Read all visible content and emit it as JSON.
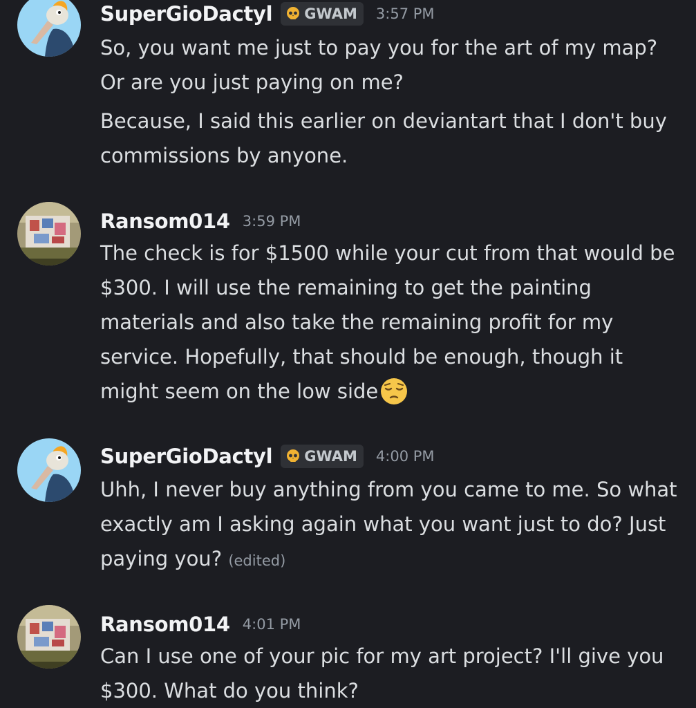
{
  "messages": [
    {
      "author": "SuperGioDactyl",
      "tag": "GWAM",
      "time": "3:57 PM",
      "lines": [
        "So, you want me just to pay you for the art of my map? Or are you just paying on me?",
        "Because, I said this earlier on deviantart that I don't buy commissions by anyone."
      ]
    },
    {
      "author": "Ransom014",
      "time": "3:59 PM",
      "lines": [
        "The check is for $1500 while your cut from that would be $300. I will use the remaining to get the painting materials and also take the remaining profit for my service. Hopefully, that should be enough, though it might seem on the low side"
      ],
      "emoji": "pensive-face"
    },
    {
      "author": "SuperGioDactyl",
      "tag": "GWAM",
      "time": "4:00 PM",
      "lines": [
        "Uhh, I never buy anything from you came to me. So what exactly am I asking again what you want just to do? Just paying you?"
      ],
      "edited": "(edited)"
    },
    {
      "author": "Ransom014",
      "time": "4:01 PM",
      "lines": [
        "Can I use one of your pic for my art project? I'll give you $300. What do you think?"
      ]
    }
  ],
  "colors": {
    "background": "#1c1d22",
    "username": "#f2f3f5",
    "text": "#dbdee1",
    "muted": "#949ba4",
    "tag_bg": "#2f3136"
  }
}
